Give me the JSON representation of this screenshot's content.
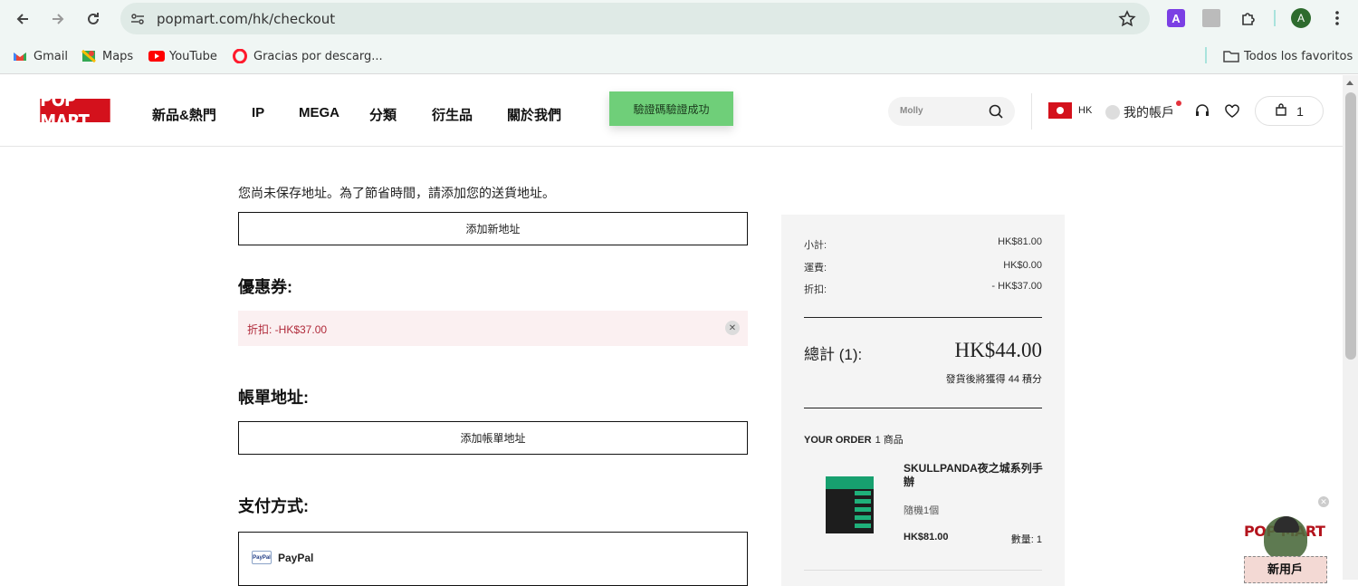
{
  "browser": {
    "url": "popmart.com/hk/checkout",
    "profile_initial": "A",
    "bookmarks": [
      "Gmail",
      "Maps",
      "YouTube",
      "Gracias por descarg..."
    ],
    "all_bookmarks": "Todos los favoritos"
  },
  "header": {
    "logo": "POP MART",
    "menu": [
      "新品&熱門",
      "IP",
      "MEGA",
      "分類",
      "衍生品",
      "關於我們"
    ],
    "toast": "驗證碼驗證成功",
    "search_placeholder": "Molly",
    "region": "HK",
    "account": "我的帳戶",
    "cart_count": "1"
  },
  "main": {
    "notice": "您尚未保存地址。為了節省時間，請添加您的送貨地址。",
    "add_address": "添加新地址",
    "coupon_title": "優惠券:",
    "coupon_text": "折扣: -HK$37.00",
    "billing_title": "帳單地址:",
    "add_billing": "添加帳單地址",
    "payment_title": "支付方式:",
    "paypal_logo": "PayPal",
    "paypal": "PayPal"
  },
  "summary": {
    "rows": [
      {
        "label": "小計:",
        "value": "HK$81.00"
      },
      {
        "label": "運費:",
        "value": "HK$0.00"
      },
      {
        "label": "折扣:",
        "value": "- HK$37.00"
      }
    ],
    "total_label": "總計 (1):",
    "total_value": "HK$44.00",
    "points": "發貨後將獲得 44 積分",
    "order_title": "YOUR ORDER",
    "order_count": "1 商品",
    "product_name": "SKULLPANDA夜之城系列手辦",
    "product_variant": "隨機1個",
    "product_price": "HK$81.00",
    "product_qty": "數量: 1"
  },
  "promo": {
    "brand": "POP MART",
    "text": "新用戶"
  },
  "colors": {
    "brand_red": "#d4111c",
    "toast_green": "#6fcf79",
    "coupon_bg": "#fbf0f1"
  }
}
